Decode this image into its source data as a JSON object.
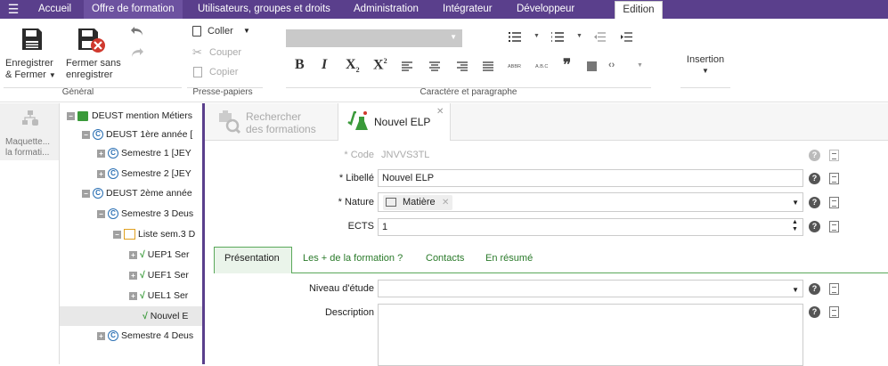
{
  "topnav": {
    "items": [
      "Accueil",
      "Offre de formation",
      "Utilisateurs, groupes et droits",
      "Administration",
      "Intégrateur",
      "Développeur"
    ],
    "edition_tab": "Edition"
  },
  "ribbon": {
    "save_label_1": "Enregistrer",
    "save_label_2": "& Fermer",
    "close_label_1": "Fermer sans",
    "close_label_2": "enregistrer",
    "paste": "Coller",
    "cut": "Couper",
    "copy": "Copier",
    "abbr": "ABBR",
    "abc": "A.B.C",
    "insertion": "Insertion",
    "groups": {
      "general": "Général",
      "clipboard": "Presse-papiers",
      "text": "Caractère et paragraphe"
    }
  },
  "leftrail": {
    "label_1": "Maquette...",
    "label_2": "la formati..."
  },
  "tree": {
    "nodes": [
      "DEUST mention Métiers",
      "DEUST 1ère année [",
      "Semestre 1 [JEY",
      "Semestre 2 [JEY",
      "DEUST 2ème année",
      "Semestre 3 Deus",
      "Liste sem.3 D",
      "UEP1 Ser",
      "UEF1 Ser",
      "UEL1 Ser",
      "Nouvel E",
      "Semestre 4 Deus"
    ]
  },
  "tabs": {
    "search_1": "Rechercher",
    "search_2": "des formations",
    "new_elp": "Nouvel ELP"
  },
  "form": {
    "code_label": "* Code",
    "code_value": "JNVVS3TL",
    "libelle_label": "* Libellé",
    "libelle_value": "Nouvel ELP",
    "nature_label": "* Nature",
    "nature_value": "Matière",
    "ects_label": "ECTS",
    "ects_value": "1",
    "niveau_label": "Niveau d'étude",
    "description_label": "Description"
  },
  "subtabs": [
    "Présentation",
    "Les + de la formation ?",
    "Contacts",
    "En résumé"
  ],
  "colors": {
    "nav_bg": "#5a3f8c",
    "accent_green": "#2a7a2a",
    "delete_red": "#d0392e"
  }
}
